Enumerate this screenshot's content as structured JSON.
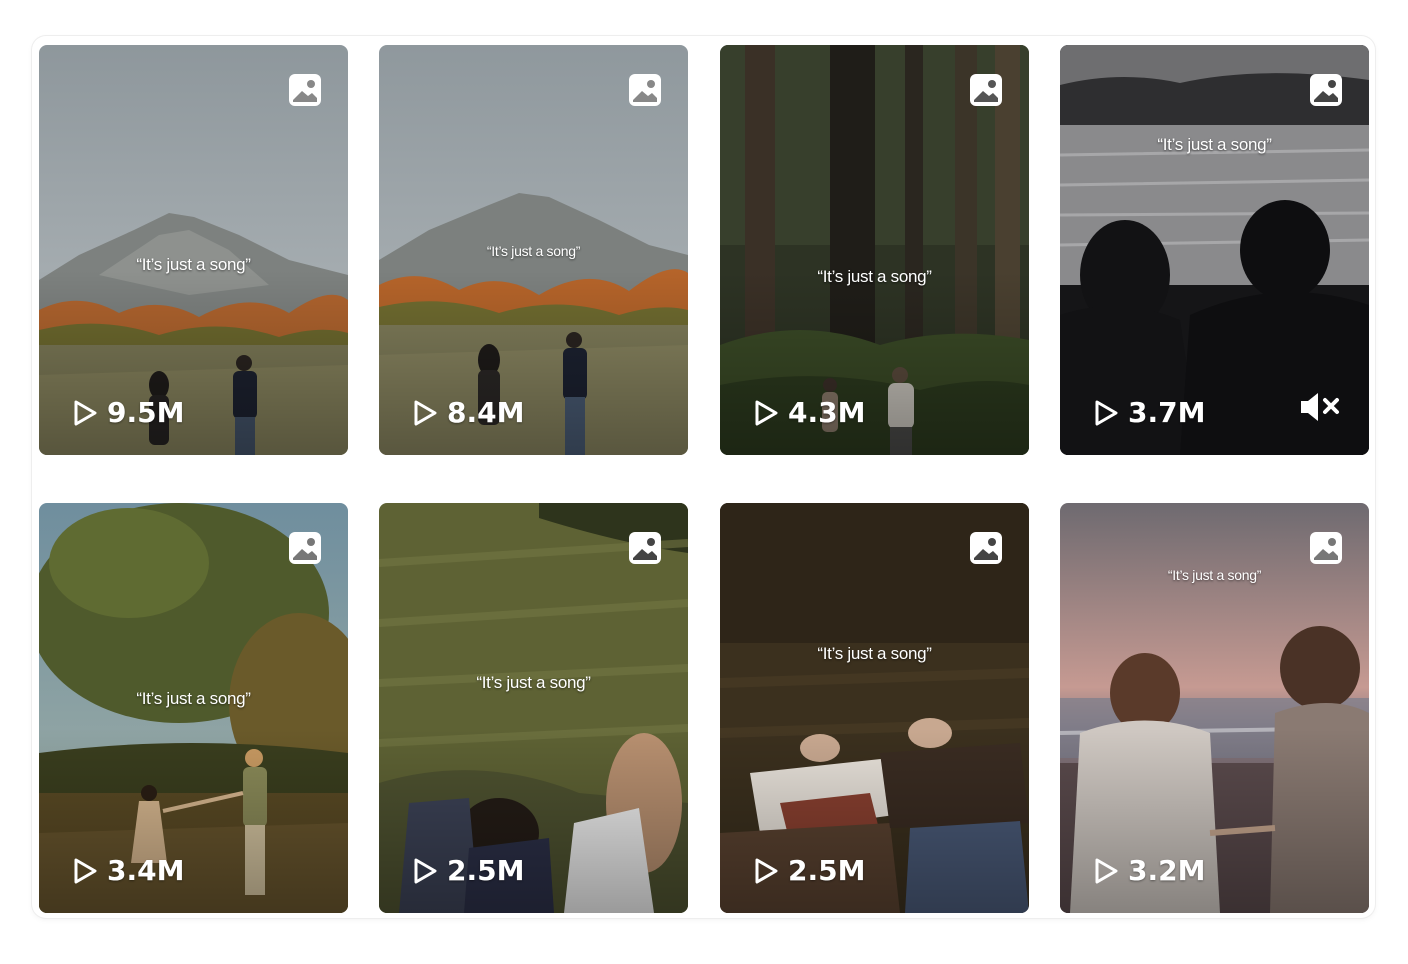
{
  "icons": {
    "media": "image-icon",
    "play": "play-icon",
    "mute": "mute-icon"
  },
  "videos": [
    {
      "caption": "“It’s just a song”",
      "views": "9.5M"
    },
    {
      "caption": "“It’s just a song”",
      "views": "8.4M"
    },
    {
      "caption": "“It’s just a song”",
      "views": "4.3M"
    },
    {
      "caption": "“It’s just a song”",
      "views": "3.7M",
      "muted": true
    },
    {
      "caption": "“It’s just a song”",
      "views": "3.4M"
    },
    {
      "caption": "“It’s just a song”",
      "views": "2.5M"
    },
    {
      "caption": "“It’s just a song”",
      "views": "2.5M"
    },
    {
      "caption": "“It’s just a song”",
      "views": "3.2M"
    }
  ]
}
